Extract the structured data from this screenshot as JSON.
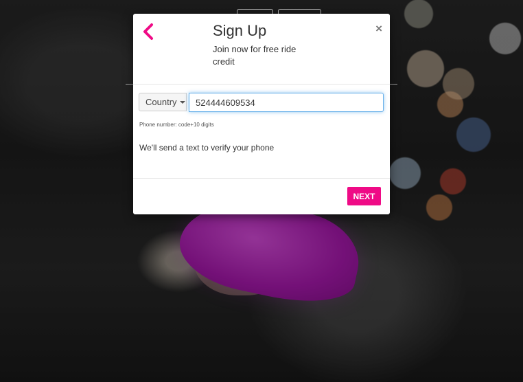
{
  "modal": {
    "title": "Sign Up",
    "subtitle": "Join now for free ride credit",
    "close_label": "×",
    "country_label": "Country",
    "phone_value": "524444609534",
    "help_text": "Phone number: code+10 digits",
    "verify_text": "We'll send a text to verify your phone",
    "next_label": "NEXT"
  },
  "icons": {
    "back": "chevron-left-icon",
    "close": "close-icon",
    "dropdown": "caret-down-icon"
  },
  "colors": {
    "accent": "#ef0a86",
    "focus_border": "#66afe9",
    "brand_mustache": "#d02ad6"
  }
}
